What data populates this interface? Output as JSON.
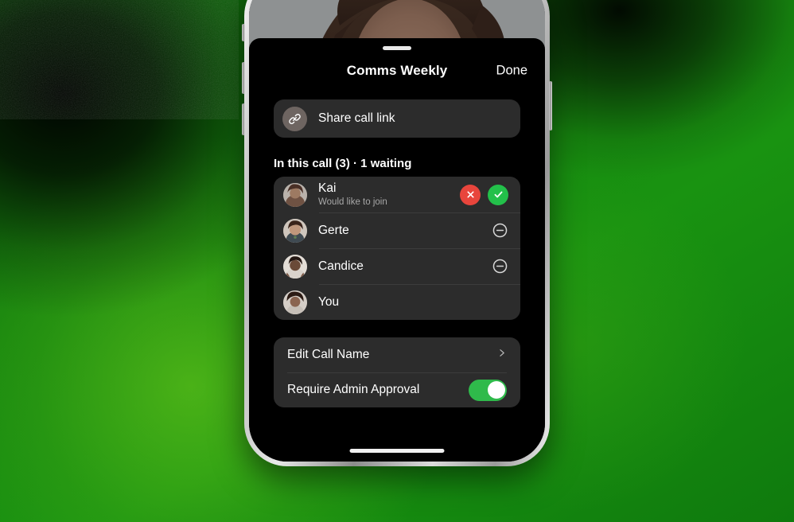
{
  "background": {
    "base_color": "#199311",
    "dark_color": "#000000"
  },
  "phone": {
    "frame_color": "#c9c9c9",
    "screen_bg": "#000000",
    "home_indicator": "home-indicator"
  },
  "video": {
    "background_color": "#8e9192",
    "description": "video-feed"
  },
  "sheet": {
    "grabber": "drag-handle",
    "title": "Comms Weekly",
    "done_label": "Done",
    "share": {
      "label": "Share call link",
      "icon": "link-icon",
      "icon_bg": "#6e6561"
    },
    "section_title": "In this call (3) · 1 waiting",
    "participants": [
      {
        "name": "Kai",
        "subtitle": "Would like to join",
        "waiting": true,
        "avatar": "avatar-kai",
        "actions": [
          "reject",
          "accept"
        ],
        "reject_label": "✕",
        "accept_label": "✓"
      },
      {
        "name": "Gerte",
        "subtitle": "",
        "waiting": false,
        "avatar": "avatar-gerte",
        "actions": [
          "remove"
        ]
      },
      {
        "name": "Candice",
        "subtitle": "",
        "waiting": false,
        "avatar": "avatar-candice",
        "actions": [
          "remove"
        ]
      },
      {
        "name": "You",
        "subtitle": "",
        "waiting": false,
        "avatar": "avatar-you",
        "actions": []
      }
    ],
    "settings": [
      {
        "label": "Edit Call Name",
        "control": "chevron"
      },
      {
        "label": "Require Admin Approval",
        "control": "toggle",
        "toggle_on": true
      }
    ]
  },
  "colors": {
    "accept_green": "#23c04a",
    "reject_red": "#e8453c",
    "toggle_on": "#2fba4b",
    "card_bg": "#2c2c2c",
    "sheet_bg": "#000000",
    "text_primary": "#ffffff",
    "text_secondary": "#a8a8a8"
  }
}
